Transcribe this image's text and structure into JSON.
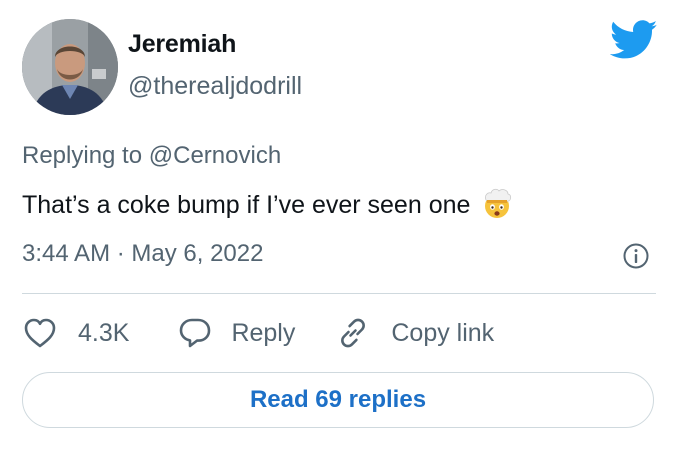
{
  "author": {
    "name": "Jeremiah",
    "handle": "@therealjdodrill"
  },
  "tweet": {
    "replying_prefix": "Replying to",
    "replying_to": "@Cernovich",
    "text": "That’s a coke bump if I’ve ever seen one",
    "emoji": "exploding-head",
    "timestamp": "3:44 AM · May 6, 2022"
  },
  "actions": {
    "like_count": "4.3K",
    "reply_label": "Reply",
    "copy_label": "Copy link"
  },
  "read_replies_label": "Read 69 replies",
  "colors": {
    "twitter_blue": "#1d9bf0",
    "link_blue": "#1d70c7",
    "text_primary": "#0f1419",
    "text_secondary": "#536471",
    "border": "#cfd9de"
  },
  "icons": [
    "twitter-bird-icon",
    "info-icon",
    "heart-icon",
    "reply-bubble-icon",
    "link-icon"
  ]
}
